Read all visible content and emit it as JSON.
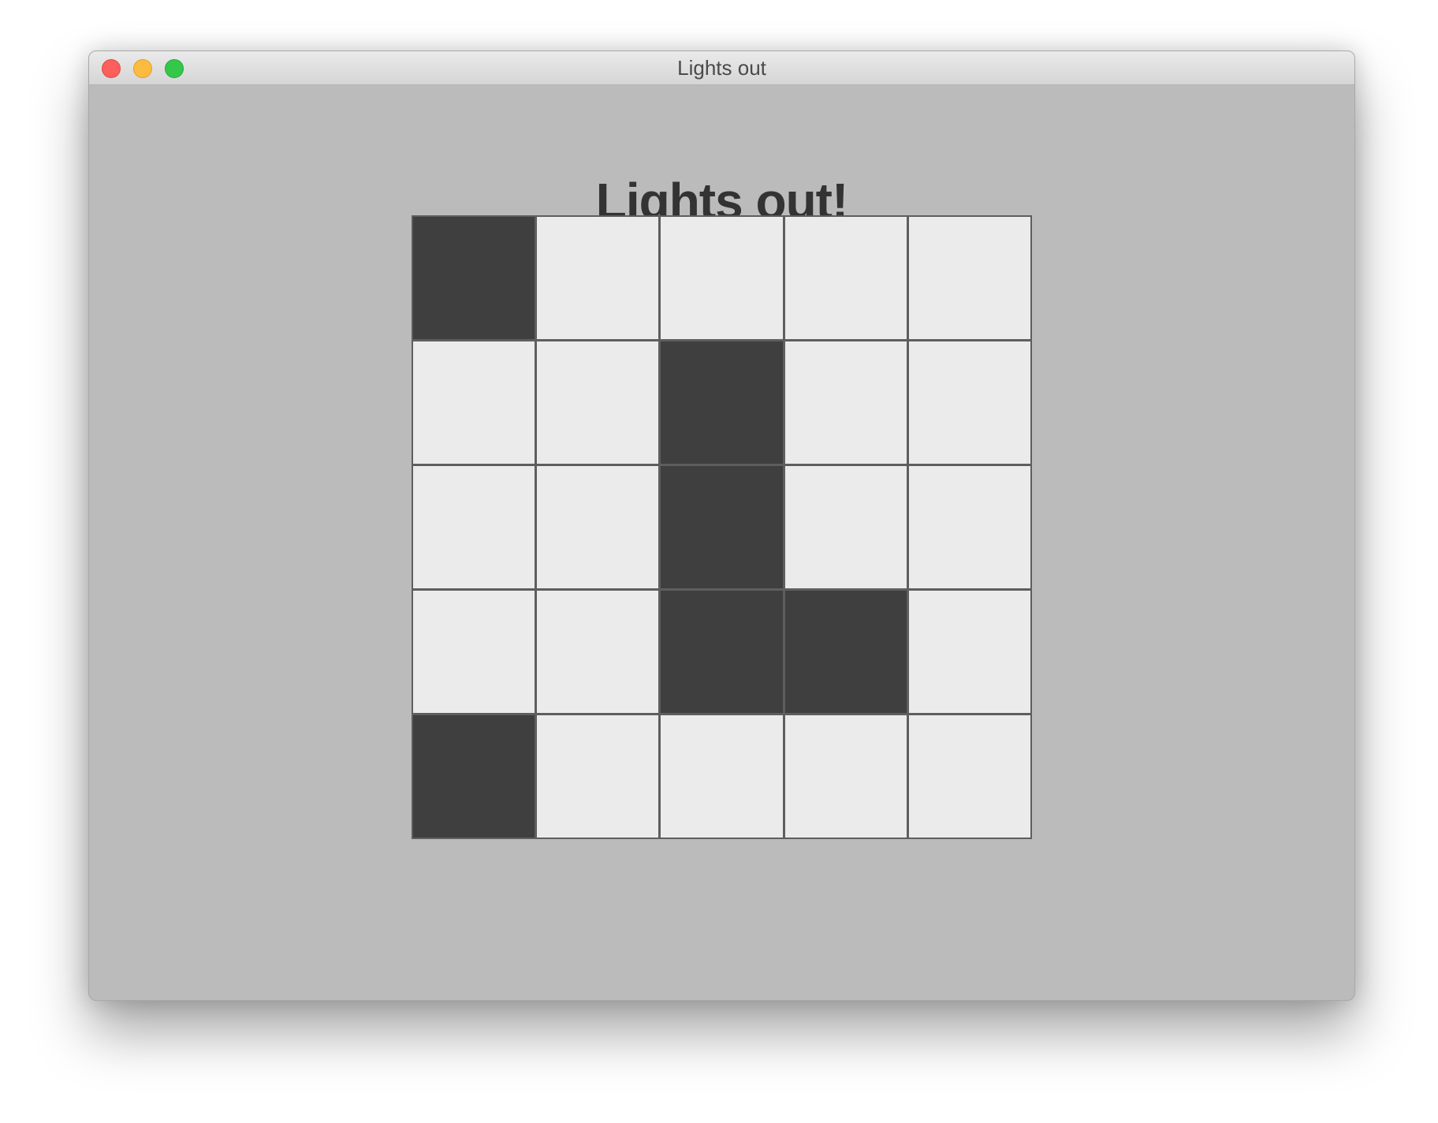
{
  "window": {
    "title": "Lights out"
  },
  "game": {
    "heading": "Lights out!",
    "rows": 5,
    "cols": 5,
    "colors": {
      "light": "#ebebeb",
      "dark": "#3f3f3f",
      "grid": "#5e5e5e"
    },
    "board": [
      [
        1,
        0,
        0,
        0,
        0
      ],
      [
        0,
        0,
        1,
        0,
        0
      ],
      [
        0,
        0,
        1,
        0,
        0
      ],
      [
        0,
        0,
        1,
        1,
        0
      ],
      [
        1,
        0,
        0,
        0,
        0
      ]
    ]
  }
}
